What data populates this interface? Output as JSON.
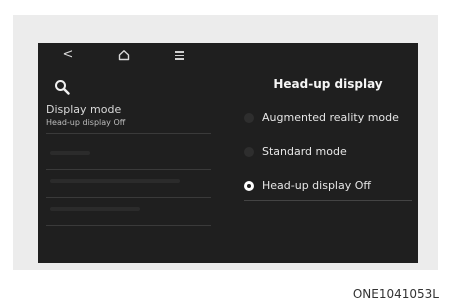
{
  "topbar": {
    "back_glyph": "<",
    "icons": [
      "back-icon",
      "home-icon",
      "menu-icon"
    ]
  },
  "search": {
    "icon": "search-icon"
  },
  "left_panel": {
    "current_title": "Display mode",
    "current_value": "Head-up display Off"
  },
  "right_panel": {
    "title": "Head-up display",
    "options": [
      {
        "label": "Augmented reality mode",
        "selected": false
      },
      {
        "label": "Standard mode",
        "selected": false
      },
      {
        "label": "Head-up display Off",
        "selected": true
      }
    ]
  },
  "caption": "ONE1041053L",
  "colors": {
    "screen_bg": "#1f1f1f",
    "bezel": "#ececec",
    "text": "#f2f2f2"
  }
}
